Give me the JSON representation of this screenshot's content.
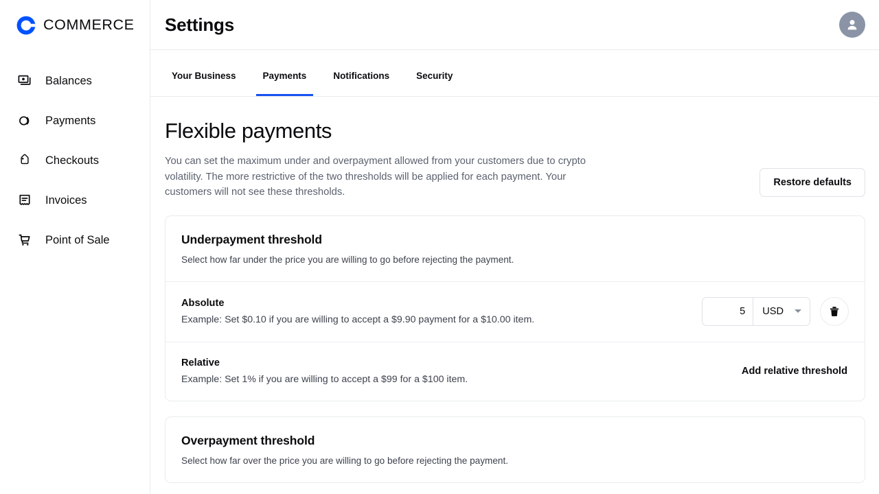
{
  "brand": {
    "name": "COMMERCE",
    "logo_color": "#0052ff"
  },
  "sidebar": {
    "items": [
      {
        "label": "Balances",
        "icon": "balances-icon"
      },
      {
        "label": "Payments",
        "icon": "payments-icon"
      },
      {
        "label": "Checkouts",
        "icon": "checkouts-tag-icon"
      },
      {
        "label": "Invoices",
        "icon": "invoices-receipt-icon"
      },
      {
        "label": "Point of Sale",
        "icon": "point-of-sale-cart-icon"
      }
    ]
  },
  "header": {
    "title": "Settings",
    "avatar_icon": "user-avatar-icon"
  },
  "tabs": [
    {
      "label": "Your Business",
      "active": false
    },
    {
      "label": "Payments",
      "active": true
    },
    {
      "label": "Notifications",
      "active": false
    },
    {
      "label": "Security",
      "active": false
    }
  ],
  "tabs_accent_color": "#1652f0",
  "main": {
    "section_title": "Flexible payments",
    "section_description": "You can set the maximum under and overpayment allowed from your customers due to crypto volatility. The more restrictive of the two thresholds will be applied for each payment. Your customers will not see these thresholds.",
    "restore_defaults_label": "Restore defaults"
  },
  "underpayment": {
    "title": "Underpayment threshold",
    "subtitle": "Select how far under the price you are willing to go before rejecting the payment.",
    "absolute": {
      "title": "Absolute",
      "example": "Example: Set $0.10 if you are willing to accept a $9.90 payment for a $10.00 item.",
      "amount_value": "5",
      "amount_placeholder": "0",
      "currency": "USD",
      "delete_icon": "trash-icon"
    },
    "relative": {
      "title": "Relative",
      "example": "Example: Set 1% if you are willing to accept a $99 for a $100 item.",
      "add_label": "Add relative threshold"
    }
  },
  "overpayment": {
    "title": "Overpayment threshold",
    "subtitle": "Select how far over the price you are willing to go before rejecting the payment."
  }
}
